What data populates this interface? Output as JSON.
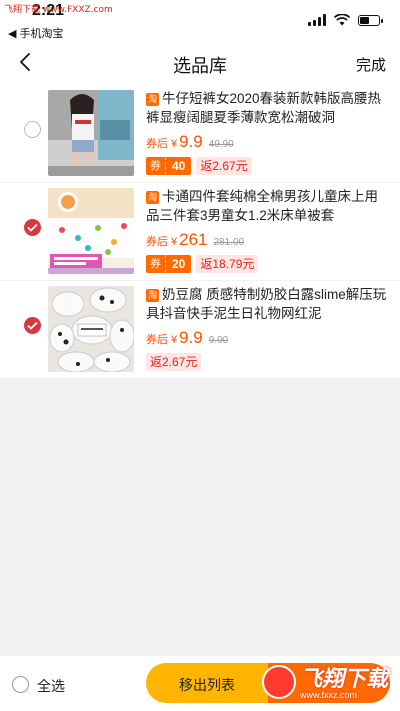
{
  "watermark_top": "飞翔下载 www.FXXZ.com",
  "status": {
    "time": "2:21",
    "back_app": "◀ 手机淘宝",
    "battery_level": 0.55
  },
  "nav": {
    "title": "选品库",
    "done": "完成"
  },
  "items": [
    {
      "selected": false,
      "tag": "淘",
      "title": "牛仔短裤女2020春装新款韩版高腰热裤显瘦阔腿夏季薄款宽松潮破洞",
      "price_label": "券后",
      "currency": "¥",
      "price": "9.9",
      "original_price": "49.90",
      "coupon_label": "券",
      "coupon_value": "40",
      "rebate": "返2.67元"
    },
    {
      "selected": true,
      "tag": "淘",
      "title": "卡通四件套纯棉全棉男孩儿童床上用品三件套3男童女1.2米床单被套",
      "price_label": "券后",
      "currency": "¥",
      "price": "261",
      "original_price": "281.00",
      "coupon_label": "券",
      "coupon_value": "20",
      "rebate": "返18.79元"
    },
    {
      "selected": true,
      "tag": "淘",
      "title": "奶豆腐 质感特制奶胶白露slime解压玩具抖音快手泥生日礼物网红泥",
      "price_label": "券后",
      "currency": "¥",
      "price": "9.9",
      "original_price": "9.90",
      "coupon_label": "",
      "coupon_value": "",
      "rebate": "返2.67元"
    }
  ],
  "bottom": {
    "select_all": "全选",
    "move_out": "移出列表"
  },
  "watermark_bottom": {
    "name": "飞翔下载",
    "url": "www.fxxz.com"
  },
  "colors": {
    "accent": "#ff5000",
    "coupon": "#ff6a00",
    "check": "#d9363e",
    "button": "#ffb400"
  }
}
